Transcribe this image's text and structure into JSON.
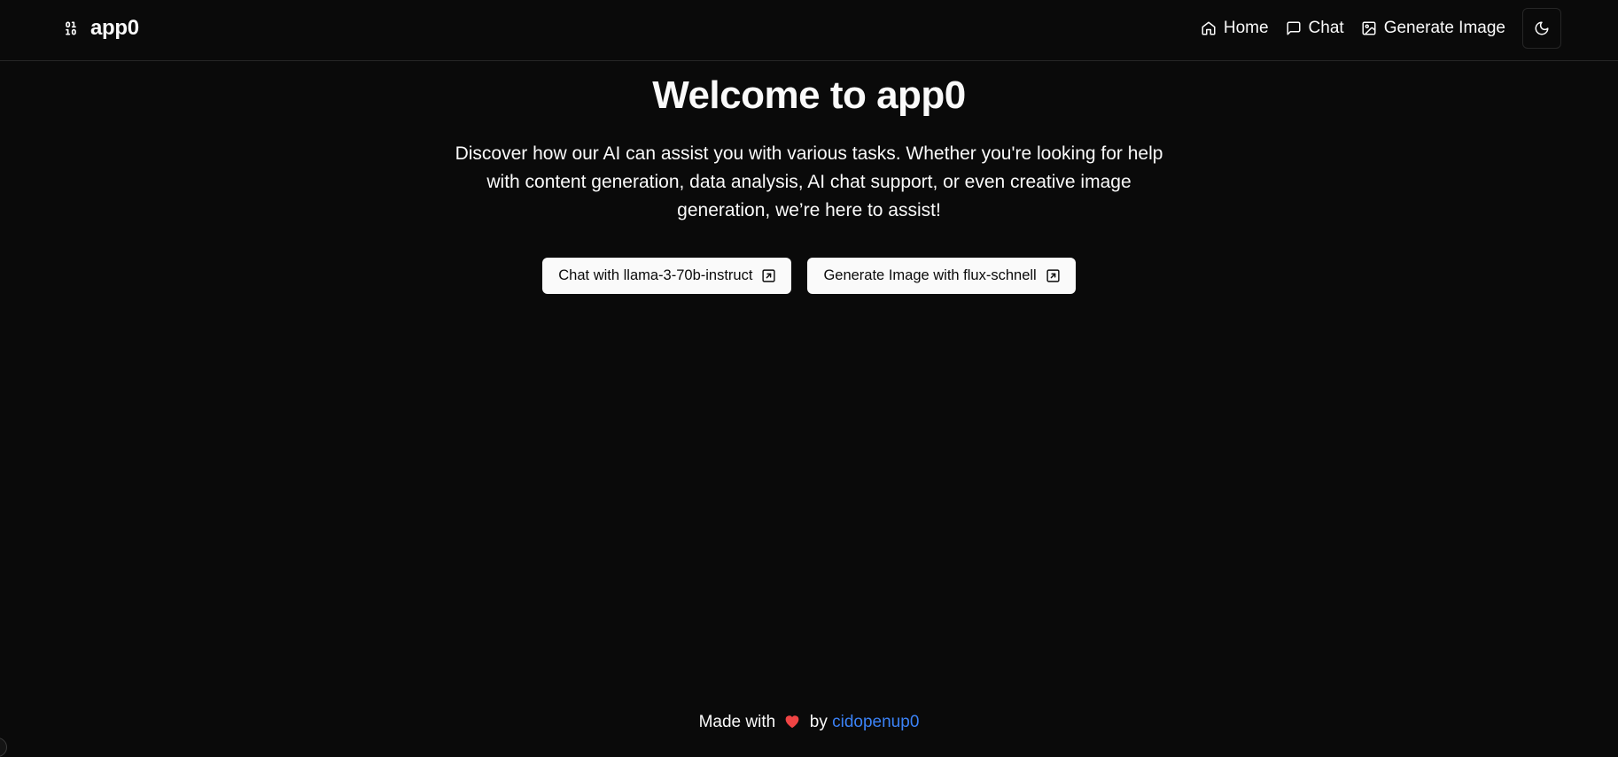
{
  "brand": {
    "name": "app0",
    "icon": "binary-icon"
  },
  "nav": {
    "items": [
      {
        "label": "Home",
        "icon": "home-icon"
      },
      {
        "label": "Chat",
        "icon": "chat-icon"
      },
      {
        "label": "Generate Image",
        "icon": "image-icon"
      }
    ],
    "theme_toggle_icon": "moon-icon"
  },
  "hero": {
    "title": "Welcome to app0",
    "subtitle": "Discover how our AI can assist you with various tasks. Whether you're looking for help with content generation, data analysis, AI chat support, or even creative image generation, we’re here to assist!",
    "buttons": [
      {
        "label": "Chat with llama-3-70b-instruct",
        "icon": "external-link-icon"
      },
      {
        "label": "Generate Image with flux-schnell",
        "icon": "external-link-icon"
      }
    ]
  },
  "footer": {
    "prefix": "Made with",
    "middle": "by",
    "author": "cidopenup0",
    "heart_icon": "heart-icon"
  },
  "colors": {
    "background": "#0a0a0a",
    "foreground": "#fafafa",
    "border": "#262626",
    "link": "#3b82f6",
    "heart": "#ef4444"
  }
}
